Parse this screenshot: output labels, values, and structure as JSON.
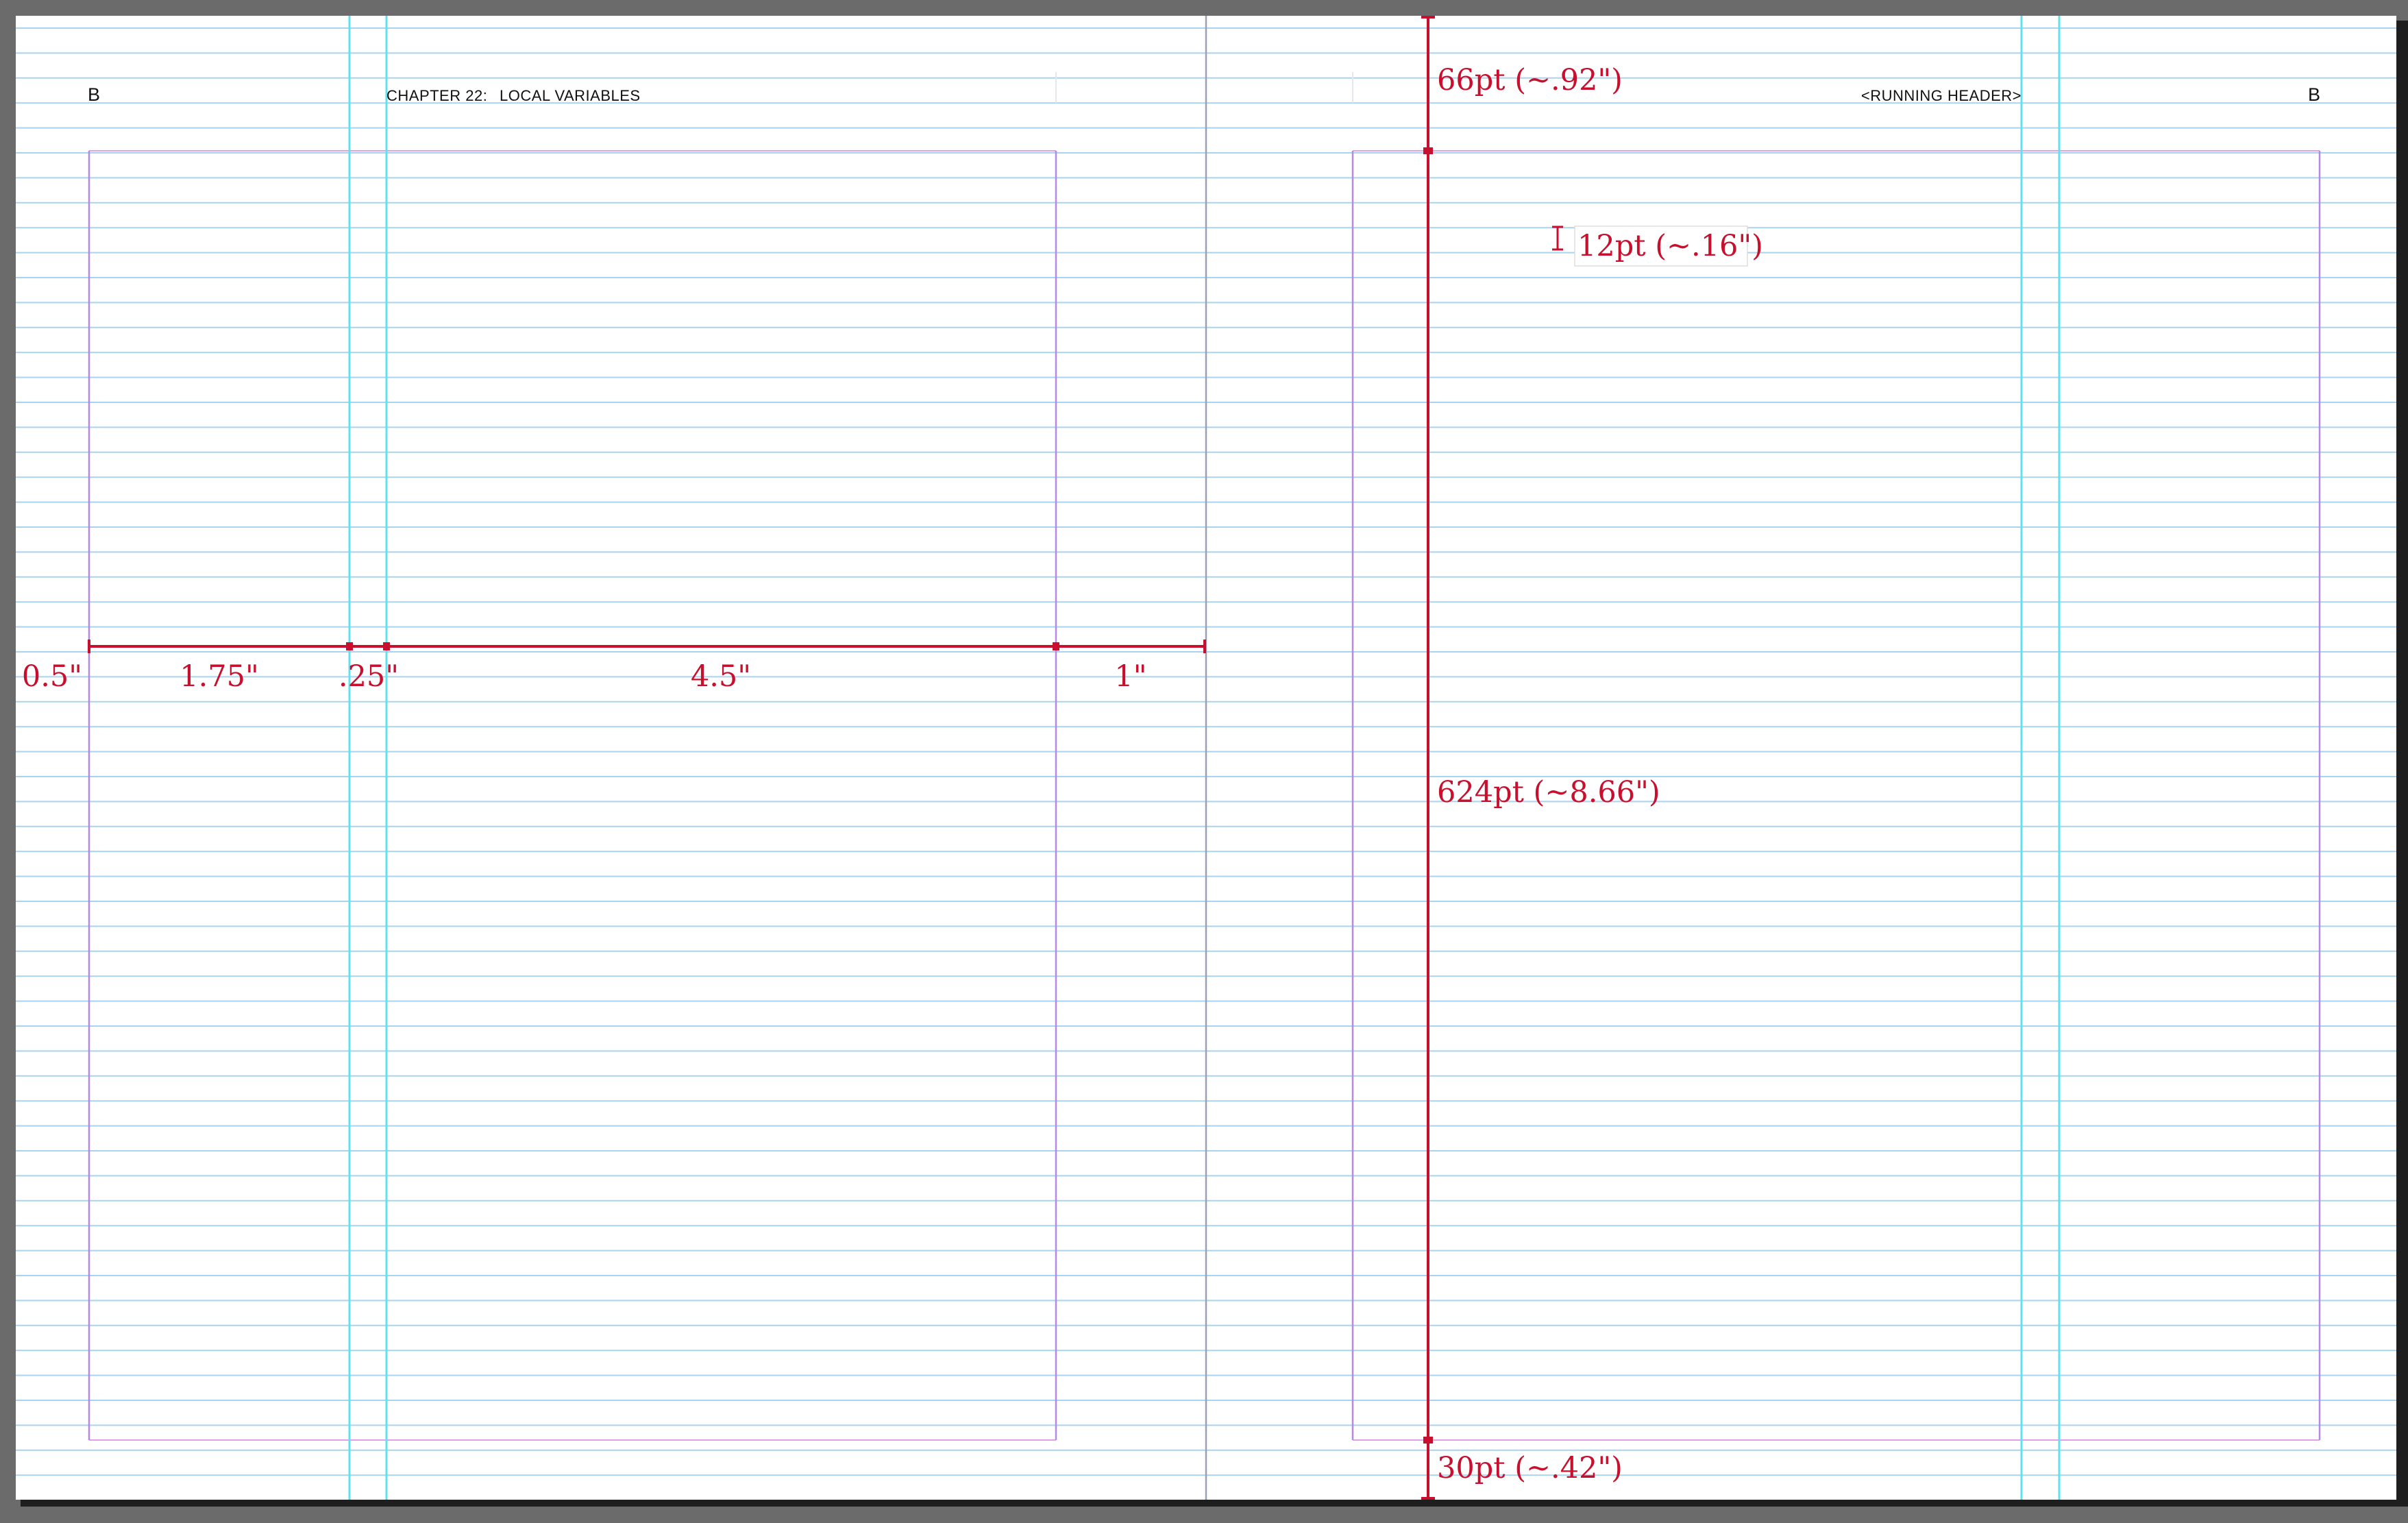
{
  "document": {
    "left_page": {
      "master_prefix": "B",
      "header_chapter": "CHAPTER 22:",
      "header_title": "LOCAL VARIABLES"
    },
    "right_page": {
      "master_prefix": "B",
      "running_header": "<RUNNING HEADER>"
    }
  },
  "measurements": {
    "horizontal": {
      "outer_margin": "0.5\"",
      "sidebar_column": "1.75\"",
      "gutter": ".25\"",
      "main_column": "4.5\"",
      "inner_margin": "1\""
    },
    "vertical": {
      "top_margin": "66pt (~.92\")",
      "baseline_grid": "12pt (~.16\")",
      "text_area_height": "624pt (~8.66\")",
      "bottom_margin": "30pt (~.42\")"
    }
  },
  "colors": {
    "pasteboard": "#6b6b6b",
    "page": "#ffffff",
    "baseline_grid": "#a9d3ee",
    "margin_guides": "#d98fd9",
    "column_guides": "#b58ae6",
    "ruler_guides": "#5ee3ee",
    "annotation": "#c8102e",
    "spine": "#9aa0b8"
  }
}
